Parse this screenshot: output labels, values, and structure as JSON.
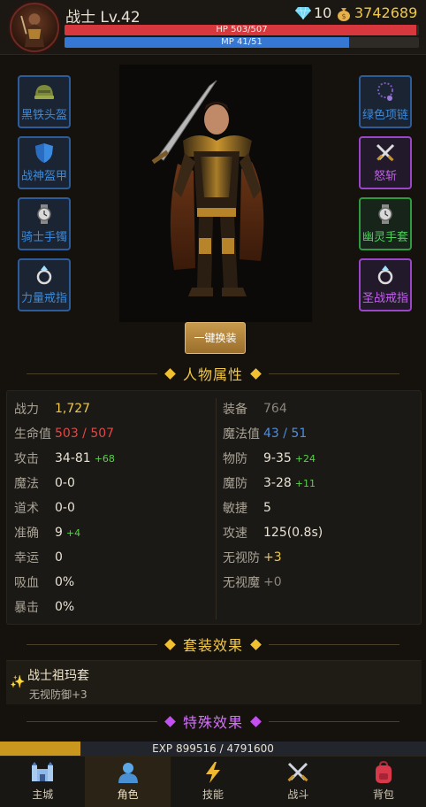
{
  "header": {
    "name": "战士 Lv.42",
    "gems": "10",
    "gold": "3742689",
    "hp_text": "HP 503/507",
    "hp_fraction": 0.992,
    "mp_text": "MP 41/51",
    "mp_fraction": 0.804
  },
  "equipment": {
    "left": [
      {
        "label": "黑铁头盔",
        "icon": "helmet-icon",
        "quality": "blue"
      },
      {
        "label": "战神盔甲",
        "icon": "shield-icon",
        "quality": "blue"
      },
      {
        "label": "骑士手镯",
        "icon": "bracelet-icon",
        "quality": "blue"
      },
      {
        "label": "力量戒指",
        "icon": "ring-icon",
        "quality": "blue"
      }
    ],
    "right": [
      {
        "label": "绿色项链",
        "icon": "necklace-icon",
        "quality": "blue"
      },
      {
        "label": "怒斩",
        "icon": "swords-icon",
        "quality": "purple"
      },
      {
        "label": "幽灵手套",
        "icon": "bracelet-icon",
        "quality": "green"
      },
      {
        "label": "圣战戒指",
        "icon": "ring-icon",
        "quality": "purple"
      }
    ],
    "equip_all_button": "一键换装"
  },
  "attributes": {
    "title": "人物属性",
    "left": [
      {
        "key": "战力",
        "value": "1,727",
        "bonus": ""
      },
      {
        "key": "生命值",
        "value": "503 / 507",
        "bonus": ""
      },
      {
        "key": "攻击",
        "value": "34-81",
        "bonus": "+68"
      },
      {
        "key": "魔法",
        "value": "0-0",
        "bonus": ""
      },
      {
        "key": "道术",
        "value": "0-0",
        "bonus": ""
      },
      {
        "key": "准确",
        "value": "9",
        "bonus": "+4"
      },
      {
        "key": "幸运",
        "value": "0",
        "bonus": ""
      },
      {
        "key": "吸血",
        "value": "0%",
        "bonus": ""
      },
      {
        "key": "暴击",
        "value": "0%",
        "bonus": ""
      }
    ],
    "right": [
      {
        "key": "装备",
        "value": "764",
        "bonus": ""
      },
      {
        "key": "魔法值",
        "value": "43 / 51",
        "bonus": ""
      },
      {
        "key": "物防",
        "value": "9-35",
        "bonus": "+24"
      },
      {
        "key": "魔防",
        "value": "3-28",
        "bonus": "+11"
      },
      {
        "key": "敏捷",
        "value": "5",
        "bonus": ""
      },
      {
        "key": "攻速",
        "value": "125(0.8s)",
        "bonus": ""
      },
      {
        "key": "无视防",
        "value": "+3",
        "bonus": ""
      },
      {
        "key": "无视魔",
        "value": "+0",
        "bonus": ""
      }
    ]
  },
  "set_effect": {
    "title": "套装效果",
    "name": "战士祖玛套",
    "effect": "无视防御+3"
  },
  "special_effect": {
    "title": "特殊效果"
  },
  "exp": {
    "text": "EXP  899516 / 4791600",
    "fraction": 0.188
  },
  "nav": [
    {
      "label": "主城",
      "icon": "castle-icon",
      "active": false
    },
    {
      "label": "角色",
      "icon": "person-icon",
      "active": true
    },
    {
      "label": "技能",
      "icon": "lightning-icon",
      "active": false
    },
    {
      "label": "战斗",
      "icon": "crossed-swords-icon",
      "active": false
    },
    {
      "label": "背包",
      "icon": "backpack-icon",
      "active": false
    }
  ],
  "colors": {
    "hp": "#d6383e",
    "mp": "#3677d4",
    "gold": "#f0c84a",
    "slot_blue": "#2d5c9a",
    "slot_purple": "#9b45c8",
    "slot_green": "#2f9a3e",
    "exp": "#c9971e"
  }
}
